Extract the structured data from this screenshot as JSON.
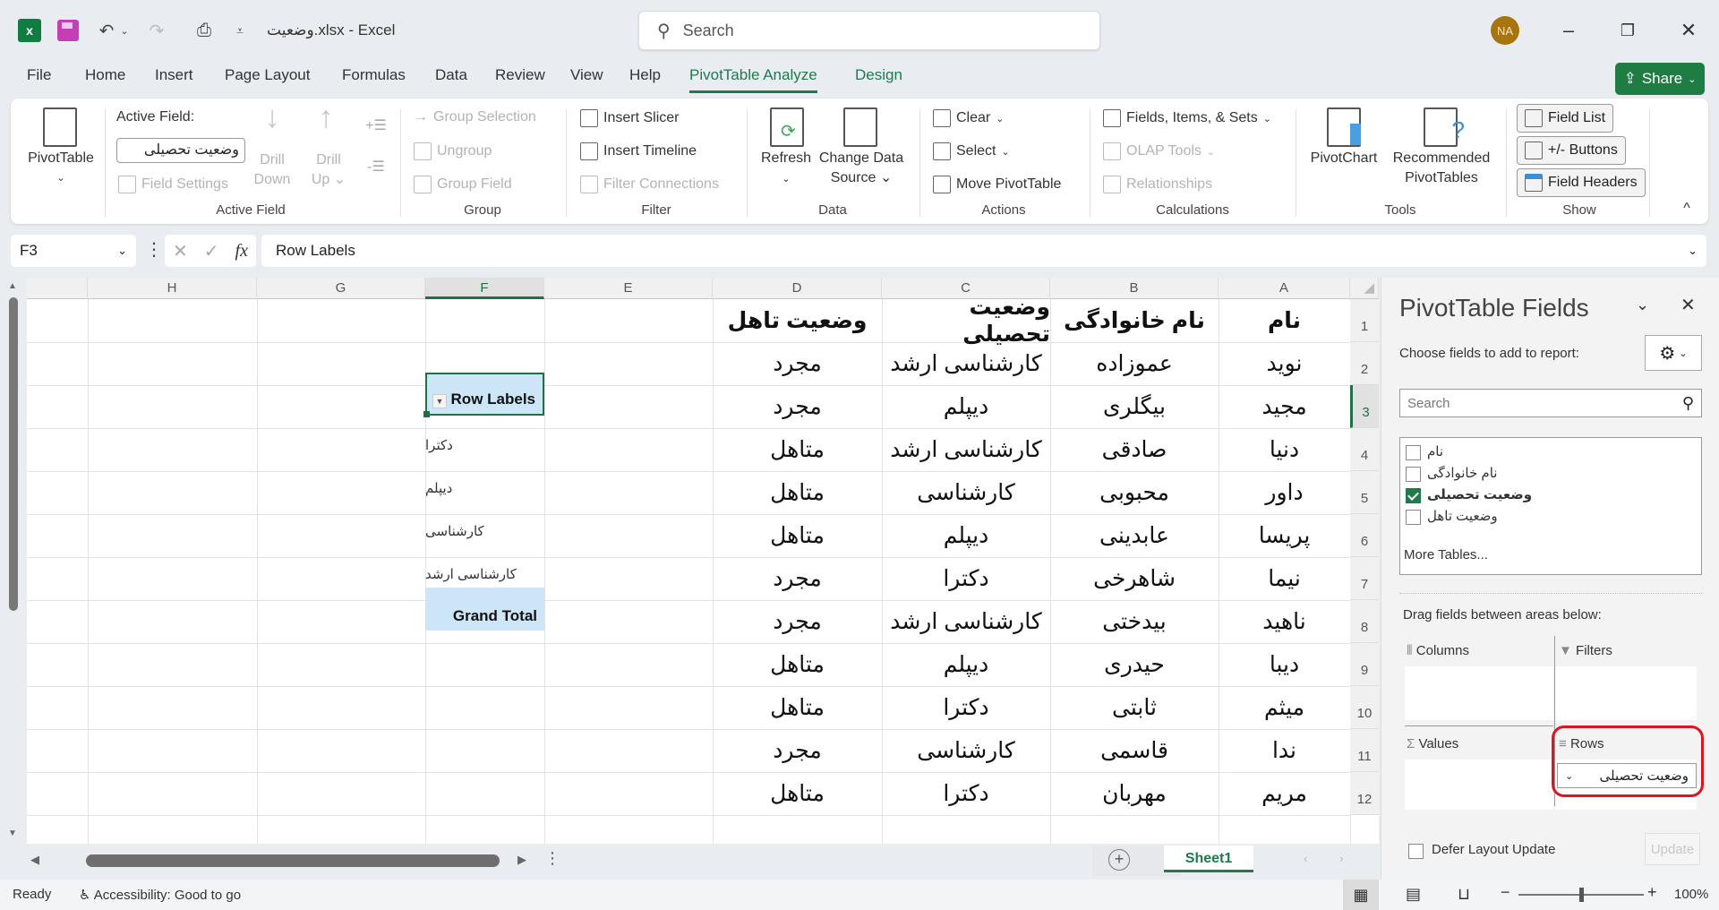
{
  "title_bar": {
    "app_icon": "excel-logo-icon",
    "doc_title": "وضعیت.xlsx  -  Excel",
    "search_placeholder": "Search",
    "user_initials": "NA",
    "colors": {
      "avatar": "#a8740d",
      "accent": "#1f7a4c"
    }
  },
  "menu": {
    "tabs": [
      "File",
      "Home",
      "Insert",
      "Page Layout",
      "Formulas",
      "Data",
      "Review",
      "View",
      "Help",
      "PivotTable Analyze",
      "Design"
    ],
    "active_tab": "PivotTable Analyze",
    "share_label": "Share"
  },
  "ribbon": {
    "pivottable": {
      "label": "PivotTable"
    },
    "active_field": {
      "title": "Active Field:",
      "value": "وضعیت تحصیلی",
      "field_settings": "Field Settings",
      "drill_down": [
        "Drill",
        "Down"
      ],
      "drill_up": [
        "Drill",
        "Up"
      ],
      "group_label": "Active Field"
    },
    "group": {
      "items": [
        "Group Selection",
        "Ungroup",
        "Group Field"
      ],
      "group_label": "Group"
    },
    "filter": {
      "items": [
        "Insert Slicer",
        "Insert Timeline",
        "Filter Connections"
      ],
      "group_label": "Filter"
    },
    "data": {
      "refresh": "Refresh",
      "change_source": [
        "Change Data",
        "Source"
      ],
      "group_label": "Data"
    },
    "actions": {
      "items": [
        "Clear",
        "Select",
        "Move PivotTable"
      ],
      "group_label": "Actions"
    },
    "calculations": {
      "items": [
        "Fields, Items, & Sets",
        "OLAP Tools",
        "Relationships"
      ],
      "group_label": "Calculations"
    },
    "tools": {
      "pivotchart": "PivotChart",
      "recommended": [
        "Recommended",
        "PivotTables"
      ],
      "group_label": "Tools"
    },
    "show": {
      "items": [
        "Field List",
        "+/- Buttons",
        "Field Headers"
      ],
      "group_label": "Show"
    }
  },
  "formula_bar": {
    "name_box": "F3",
    "formula": "Row Labels"
  },
  "sheet": {
    "columns": [
      "H",
      "G",
      "F",
      "E",
      "D",
      "C",
      "B",
      "A"
    ],
    "selected_column": "F",
    "rows": [
      "1",
      "2",
      "3",
      "4",
      "5",
      "6",
      "7",
      "8",
      "9",
      "10",
      "11",
      "12"
    ],
    "selected_row": "3",
    "table_headers": [
      "نام",
      "نام خانوادگی",
      "وضعیت تحصیلی",
      "وضعیت تاهل"
    ],
    "table_rows": [
      [
        "نوید",
        "عموزاده",
        "کارشناسی ارشد",
        "مجرد"
      ],
      [
        "مجید",
        "بیگلری",
        "دیپلم",
        "مجرد"
      ],
      [
        "دنیا",
        "صادقی",
        "کارشناسی ارشد",
        "متاهل"
      ],
      [
        "داور",
        "محبوبی",
        "کارشناسی",
        "متاهل"
      ],
      [
        "پریسا",
        "عابدینی",
        "دیپلم",
        "متاهل"
      ],
      [
        "نیما",
        "شاهرخی",
        "دکترا",
        "مجرد"
      ],
      [
        "ناهید",
        "بیدختی",
        "کارشناسی ارشد",
        "مجرد"
      ],
      [
        "دیبا",
        "حیدری",
        "دیپلم",
        "متاهل"
      ],
      [
        "میثم",
        "ثابتی",
        "دکترا",
        "متاهل"
      ],
      [
        "ندا",
        "قاسمی",
        "کارشناسی",
        "مجرد"
      ],
      [
        "مریم",
        "مهربان",
        "دکترا",
        "متاهل"
      ]
    ],
    "pivot": {
      "header": "Row Labels",
      "items": [
        "دکترا",
        "دیپلم",
        "کارشناسی",
        "کارشناسی ارشد"
      ],
      "grand_total": "Grand Total"
    },
    "tabs": [
      "Sheet1"
    ],
    "active_tab": "Sheet1"
  },
  "pivot_pane": {
    "title": "PivotTable Fields",
    "choose_label": "Choose fields to add to report:",
    "search_placeholder": "Search",
    "fields": [
      {
        "name": "نام",
        "checked": false
      },
      {
        "name": "نام خانوادگی",
        "checked": false
      },
      {
        "name": "وضعیت تحصیلی",
        "checked": true
      },
      {
        "name": "وضعیت تاهل",
        "checked": false
      }
    ],
    "more_tables": "More Tables...",
    "drag_label": "Drag fields between areas below:",
    "areas": {
      "columns": "Columns",
      "filters": "Filters",
      "values": "Values",
      "rows": "Rows"
    },
    "rows_field": "وضعیت تحصیلی",
    "defer_label": "Defer Layout Update",
    "update_label": "Update",
    "highlight_color": "#e0131f"
  },
  "status_bar": {
    "ready": "Ready",
    "accessibility": "Accessibility: Good to go",
    "zoom": "100%",
    "zoom_level_percent": 100
  }
}
